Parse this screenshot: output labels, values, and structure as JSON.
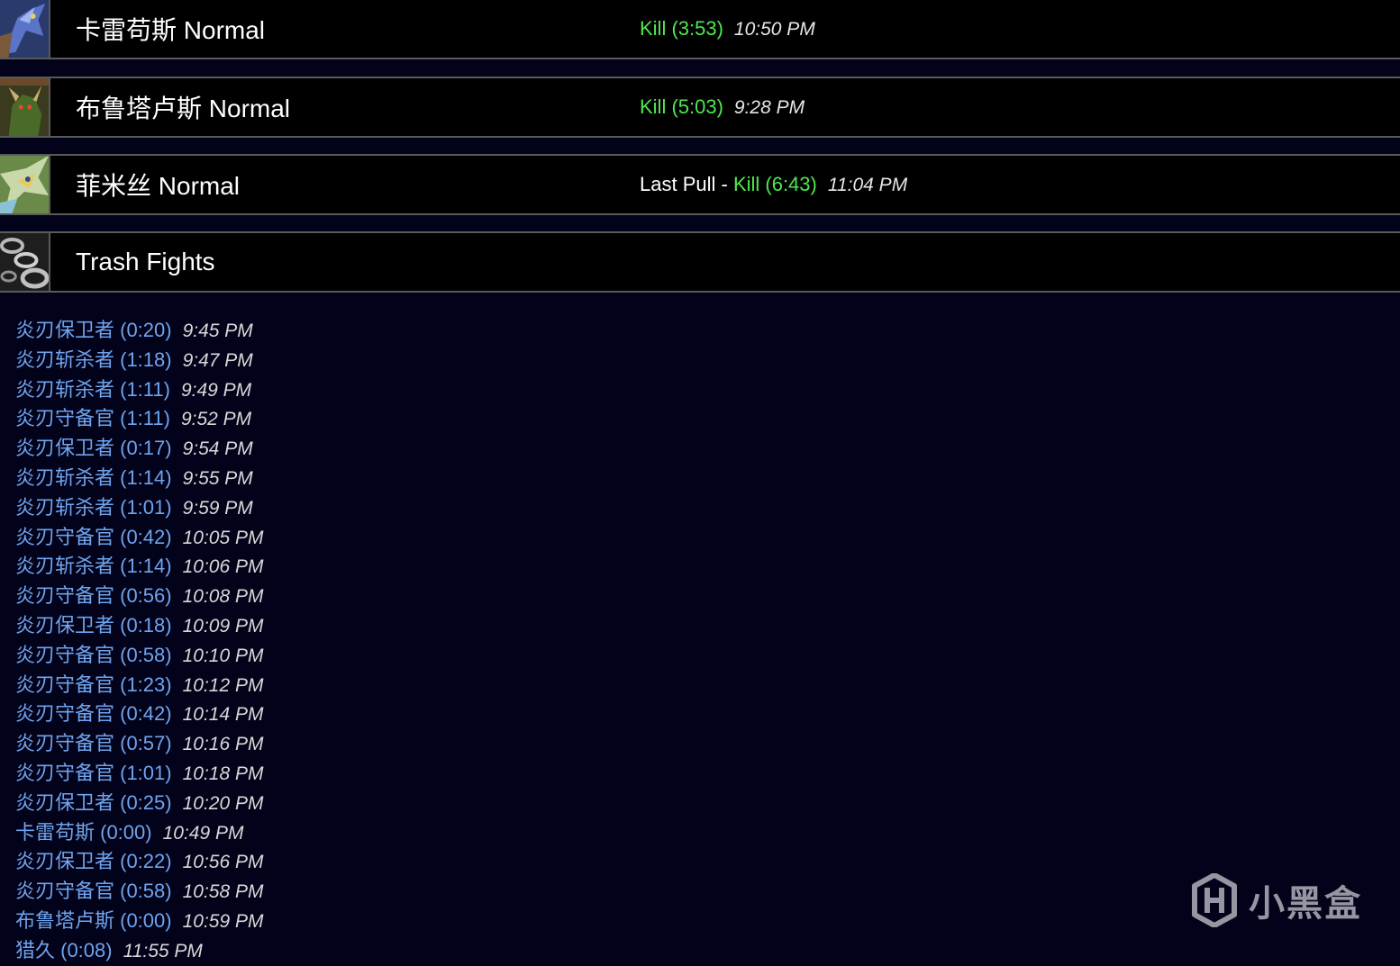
{
  "bosses": [
    {
      "name": "卡雷苟斯 Normal",
      "icon": "dragon-boss-icon",
      "prefix": "",
      "result": "Kill (3:53)",
      "time": "10:50 PM"
    },
    {
      "name": "布鲁塔卢斯 Normal",
      "icon": "demon-boss-icon",
      "prefix": "",
      "result": "Kill (5:03)",
      "time": "9:28 PM"
    },
    {
      "name": "菲米丝 Normal",
      "icon": "felmyst-boss-icon",
      "prefix": "Last Pull - ",
      "result": "Kill (6:43)",
      "time": "11:04 PM"
    },
    {
      "name": "Trash Fights",
      "icon": "chain-icon",
      "prefix": "",
      "result": "",
      "time": ""
    }
  ],
  "trash": [
    {
      "name": "炎刃保卫者 (0:20)",
      "time": "9:45 PM"
    },
    {
      "name": "炎刃斩杀者 (1:18)",
      "time": "9:47 PM"
    },
    {
      "name": "炎刃斩杀者 (1:11)",
      "time": "9:49 PM"
    },
    {
      "name": "炎刃守备官 (1:11)",
      "time": "9:52 PM"
    },
    {
      "name": "炎刃保卫者 (0:17)",
      "time": "9:54 PM"
    },
    {
      "name": "炎刃斩杀者 (1:14)",
      "time": "9:55 PM"
    },
    {
      "name": "炎刃斩杀者 (1:01)",
      "time": "9:59 PM"
    },
    {
      "name": "炎刃守备官 (0:42)",
      "time": "10:05 PM"
    },
    {
      "name": "炎刃斩杀者 (1:14)",
      "time": "10:06 PM"
    },
    {
      "name": "炎刃守备官 (0:56)",
      "time": "10:08 PM"
    },
    {
      "name": "炎刃保卫者 (0:18)",
      "time": "10:09 PM"
    },
    {
      "name": "炎刃守备官 (0:58)",
      "time": "10:10 PM"
    },
    {
      "name": "炎刃守备官 (1:23)",
      "time": "10:12 PM"
    },
    {
      "name": "炎刃守备官 (0:42)",
      "time": "10:14 PM"
    },
    {
      "name": "炎刃守备官 (0:57)",
      "time": "10:16 PM"
    },
    {
      "name": "炎刃守备官 (1:01)",
      "time": "10:18 PM"
    },
    {
      "name": "炎刃保卫者 (0:25)",
      "time": "10:20 PM"
    },
    {
      "name": "卡雷苟斯 (0:00)",
      "time": "10:49 PM"
    },
    {
      "name": "炎刃保卫者 (0:22)",
      "time": "10:56 PM"
    },
    {
      "name": "炎刃守备官 (0:58)",
      "time": "10:58 PM"
    },
    {
      "name": "布鲁塔卢斯 (0:00)",
      "time": "10:59 PM"
    },
    {
      "name": "猎久 (0:08)",
      "time": "11:55 PM"
    }
  ],
  "watermark": {
    "text": "小黑盒",
    "icon": "heybox-logo-icon"
  },
  "colors": {
    "background": "#02021a",
    "row_background": "#000000",
    "kill": "#4ee84e",
    "trash_link": "#6fa4ee",
    "border": "#5a5a5a"
  }
}
